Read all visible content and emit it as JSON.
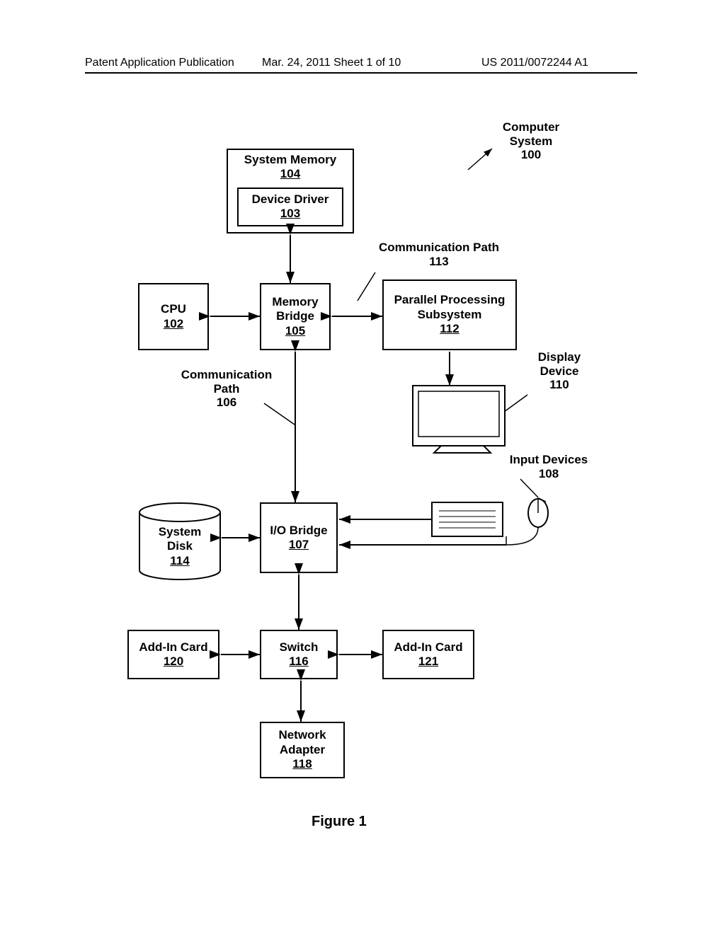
{
  "header": {
    "left": "Patent Application Publication",
    "center": "Mar. 24, 2011  Sheet 1 of 10",
    "right": "US 2011/0072244 A1"
  },
  "labels": {
    "computer_system": "Computer\nSystem\n100",
    "comm_path_113": "Communication Path\n113",
    "comm_path_106": "Communication\nPath\n106",
    "display_device": "Display\nDevice\n110",
    "input_devices": "Input Devices\n108",
    "figure": "Figure 1"
  },
  "blocks": {
    "system_memory": {
      "title": "System Memory",
      "ref": "104"
    },
    "device_driver": {
      "title": "Device Driver",
      "ref": "103"
    },
    "cpu": {
      "title": "CPU",
      "ref": "102"
    },
    "memory_bridge": {
      "title": "Memory\nBridge",
      "ref": "105"
    },
    "pps": {
      "title": "Parallel Processing\nSubsystem",
      "ref": "112"
    },
    "io_bridge": {
      "title": "I/O Bridge",
      "ref": "107"
    },
    "system_disk": {
      "title": "System\nDisk",
      "ref": "114"
    },
    "addin120": {
      "title": "Add-In Card",
      "ref": "120"
    },
    "switch": {
      "title": "Switch",
      "ref": "116"
    },
    "addin121": {
      "title": "Add-In Card",
      "ref": "121"
    },
    "network_adapter": {
      "title": "Network\nAdapter",
      "ref": "118"
    }
  }
}
